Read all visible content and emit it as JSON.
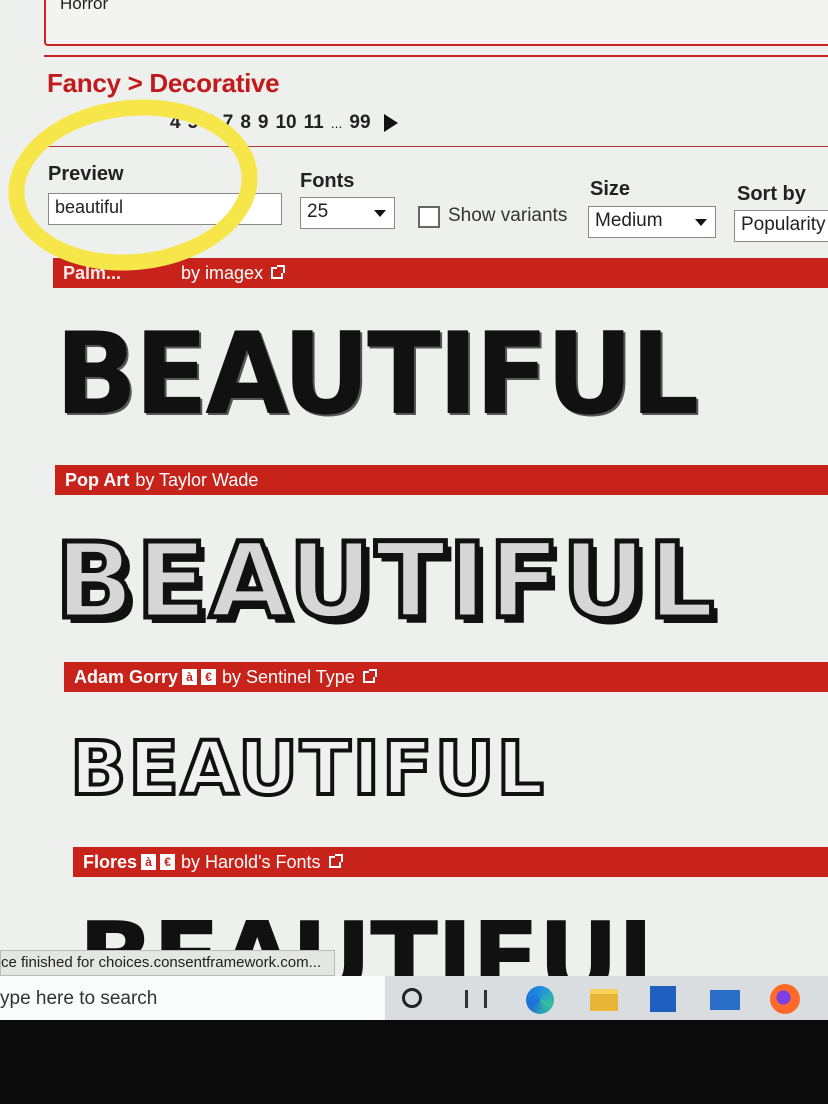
{
  "prev_category": "Horror",
  "breadcrumb": "Fancy > Decorative",
  "pager": {
    "pages": [
      "4",
      "5",
      "6",
      "7",
      "8",
      "9",
      "10",
      "11"
    ],
    "ellipsis": "...",
    "last": "99"
  },
  "controls": {
    "preview_label": "Preview",
    "preview_value": "beautiful",
    "fonts_label": "Fonts",
    "fonts_value": "25",
    "show_variants_label": "Show variants",
    "size_label": "Size",
    "size_value": "Medium",
    "sort_label": "Sort by",
    "sort_value": "Popularity"
  },
  "fonts": [
    {
      "name": "Palm...",
      "by": "by imagex",
      "sample": "BEAUTIFUL"
    },
    {
      "name": "Pop Art",
      "by": "by Taylor Wade",
      "sample": "BEAUTIFUL"
    },
    {
      "name": "Adam Gorry",
      "badges": [
        "à",
        "€"
      ],
      "by": "by Sentinel Type",
      "sample": "BEAUTIFUL"
    },
    {
      "name": "Flores",
      "badges": [
        "à",
        "€"
      ],
      "by": "by Harold's Fonts",
      "sample": "BEAUTIFUL"
    }
  ],
  "status_text": "ce finished for choices.consentframework.com...",
  "taskbar": {
    "search_placeholder": "ype here to search"
  },
  "colors": {
    "accent_red": "#c8231a",
    "highlight_yellow": "#f6e64a"
  },
  "icons": [
    "cortana-icon",
    "task-view-icon",
    "edge-icon",
    "file-explorer-icon",
    "store-icon",
    "mail-icon",
    "firefox-icon"
  ]
}
